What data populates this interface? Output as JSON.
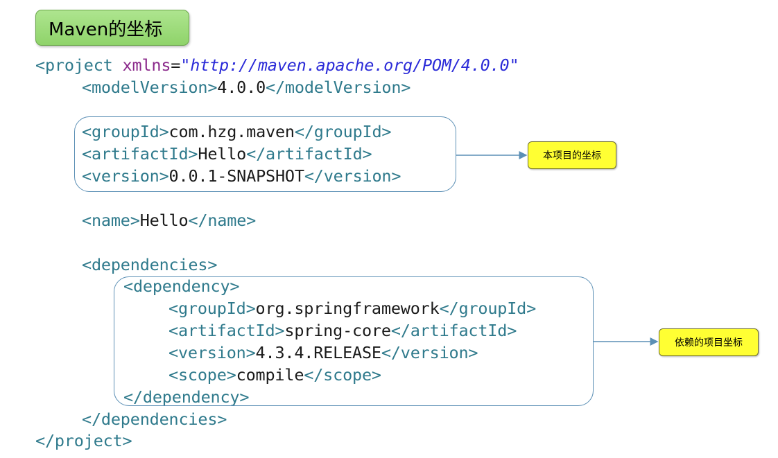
{
  "title": "Maven的坐标",
  "code": {
    "project_open": "<project",
    "xmlns_attr": "xmlns",
    "eq": "=",
    "xmlns_value": "\"http://maven.apache.org/POM/4.0.0\"",
    "model_open": "<modelVersion>",
    "model_value": "4.0.0",
    "model_close": "</modelVersion>",
    "group_open": "<groupId>",
    "group_value": "com.hzg.maven",
    "group_close": "</groupId>",
    "artifact_open": "<artifactId>",
    "artifact_value": "Hello",
    "artifact_close": "</artifactId>",
    "version_open": "<version>",
    "version_value": "0.0.1-SNAPSHOT",
    "version_close": "</version>",
    "name_open": "<name>",
    "name_value": "Hello",
    "name_close": "</name>",
    "deps_open": "<dependencies>",
    "dep_open": "<dependency>",
    "dgroup_open": "<groupId>",
    "dgroup_value": "org.springframework",
    "dgroup_close": "</groupId>",
    "dartifact_open": "<artifactId>",
    "dartifact_value": "spring-core",
    "dartifact_close": "</artifactId>",
    "dversion_open": "<version>",
    "dversion_value": "4.3.4.RELEASE",
    "dversion_close": "</version>",
    "dscope_open": "<scope>",
    "dscope_value": "compile",
    "dscope_close": "</scope>",
    "dep_close": "</dependency>",
    "deps_close": "</dependencies>",
    "project_close": "</project>"
  },
  "notes": {
    "project_coords": "本项目的坐标",
    "dependency_coords": "依赖的项目坐标"
  },
  "colors": {
    "tag": "#2f7a8c",
    "attribute": "#8b2a8b",
    "string": "#2b2bd8",
    "frame": "#5b8fb5",
    "note_fill": "#ffff33",
    "title_fill": "#9ddc7a"
  }
}
